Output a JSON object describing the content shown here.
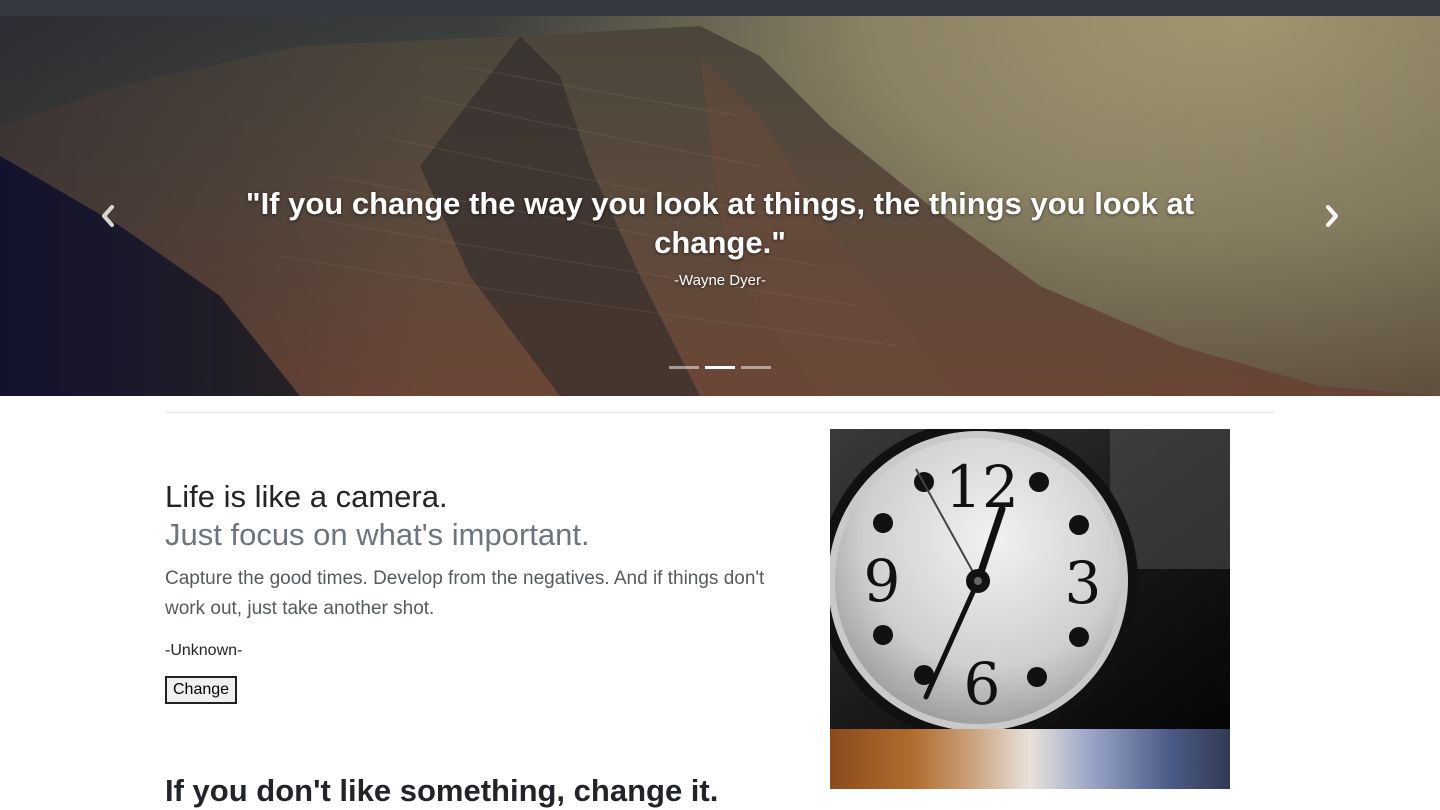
{
  "carousel": {
    "quote": "\"If you change the way you look at things, the things you look at change.\"",
    "author": "-Wayne Dyer-",
    "prev_icon": "chevron-left-icon",
    "next_icon": "chevron-right-icon",
    "slide_count": 3,
    "active_slide": 2
  },
  "feature": {
    "heading": "Life is like a camera.",
    "subheading": "Just focus on what's important.",
    "lead": "Capture the good times. Develop from the negatives. And if things don't work out, just take another shot.",
    "author": "-Unknown-",
    "button_label": "Change",
    "image_alt": "clock"
  },
  "next_feature": {
    "heading": "If you don't like something, change it."
  },
  "colors": {
    "topbar": "#343a40",
    "muted": "#6c757d"
  }
}
